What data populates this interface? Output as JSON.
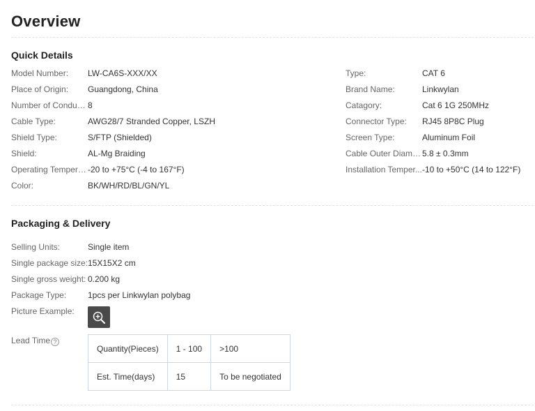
{
  "overview": {
    "title": "Overview"
  },
  "quick_details": {
    "heading": "Quick Details",
    "left": [
      {
        "label": "Model Number:",
        "value": "LW-CA6S-XXX/XX"
      },
      {
        "label": "Place of Origin:",
        "value": "Guangdong, China"
      },
      {
        "label": "Number of Conduc...",
        "value": "8"
      },
      {
        "label": "Cable Type:",
        "value": "AWG28/7 Stranded Copper, LSZH"
      },
      {
        "label": "Shield Type:",
        "value": "S/FTP (Shielded)"
      },
      {
        "label": "Shield:",
        "value": "AL-Mg Braiding"
      },
      {
        "label": "Operating Tempera...",
        "value": "-20 to +75°C (-4 to 167°F)"
      },
      {
        "label": "Color:",
        "value": "BK/WH/RD/BL/GN/YL"
      }
    ],
    "right": [
      {
        "label": "Type:",
        "value": "CAT 6"
      },
      {
        "label": "Brand Name:",
        "value": "Linkwylan"
      },
      {
        "label": "Catagory:",
        "value": "Cat 6 1G 250MHz"
      },
      {
        "label": "Connector Type:",
        "value": "RJ45 8P8C Plug"
      },
      {
        "label": "Screen Type:",
        "value": "Aluminum Foil"
      },
      {
        "label": "Cable Outer Diamet...",
        "value": "5.8 ± 0.3mm"
      },
      {
        "label": "Installation Temper...",
        "value": "-10 to +50°C (14 to 122°F)"
      }
    ]
  },
  "packaging": {
    "heading": "Packaging & Delivery",
    "rows": [
      {
        "label": "Selling Units:",
        "value": "Single item"
      },
      {
        "label": "Single package size:",
        "value": "15X15X2 cm"
      },
      {
        "label": "Single gross weight:",
        "value": "0.200 kg"
      },
      {
        "label": "Package Type:",
        "value": "1pcs per Linkwylan polybag"
      },
      {
        "label": "Picture Example:",
        "value": ""
      }
    ],
    "picture_icon": "zoom-in-icon",
    "lead_time": {
      "label": "Lead Time",
      "help_icon": "?",
      "table": [
        [
          "Quantity(Pieces)",
          "1 - 100",
          ">100"
        ],
        [
          "Est. Time(days)",
          "15",
          "To be negotiated"
        ]
      ]
    }
  },
  "colors": {
    "table_border": "#c9d6ec",
    "label_text": "#666666",
    "value_text": "#333333"
  }
}
